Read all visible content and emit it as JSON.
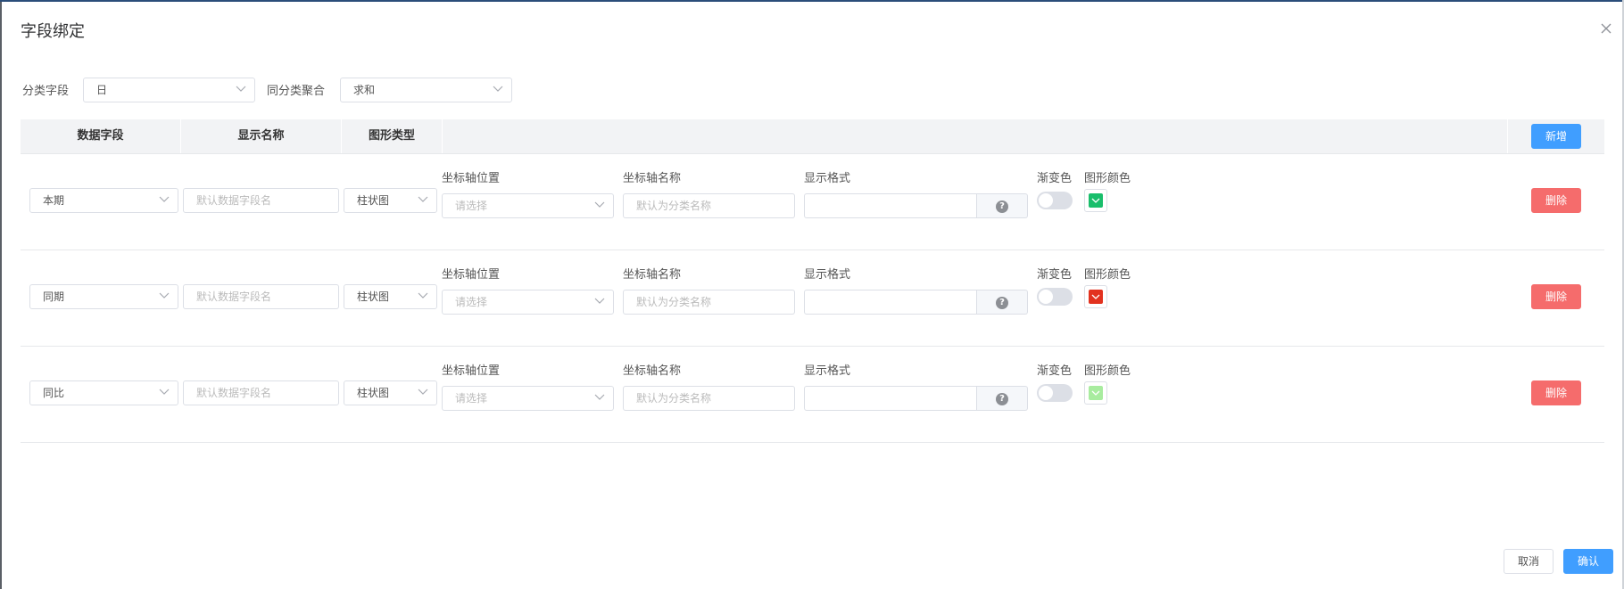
{
  "dialog": {
    "title": "字段绑定"
  },
  "filters": {
    "category_label": "分类字段",
    "category_value": "日",
    "aggregate_label": "同分类聚合",
    "aggregate_value": "求和"
  },
  "table": {
    "headers": [
      "数据字段",
      "显示名称",
      "图形类型"
    ],
    "add_label": "新增"
  },
  "row_labels": {
    "axis_position": "坐标轴位置",
    "axis_name": "坐标轴名称",
    "display_format": "显示格式",
    "gradient": "渐变色",
    "shape_color": "图形颜色"
  },
  "placeholders": {
    "display_name": "默认数据字段名",
    "axis_position": "请选择",
    "axis_name": "默认为分类名称"
  },
  "rows": [
    {
      "field": "本期",
      "chart_type": "柱状图",
      "color": "#19be6b",
      "delete_label": "删除"
    },
    {
      "field": "同期",
      "chart_type": "柱状图",
      "color": "#e2321f",
      "delete_label": "删除"
    },
    {
      "field": "同比",
      "chart_type": "柱状图",
      "color": "#a8ec9f",
      "delete_label": "删除"
    }
  ],
  "help_glyph": "?",
  "footer": {
    "cancel_label": "取消",
    "confirm_label": "确认"
  },
  "colors": {
    "primary": "#409eff",
    "danger": "#f56c6c"
  }
}
